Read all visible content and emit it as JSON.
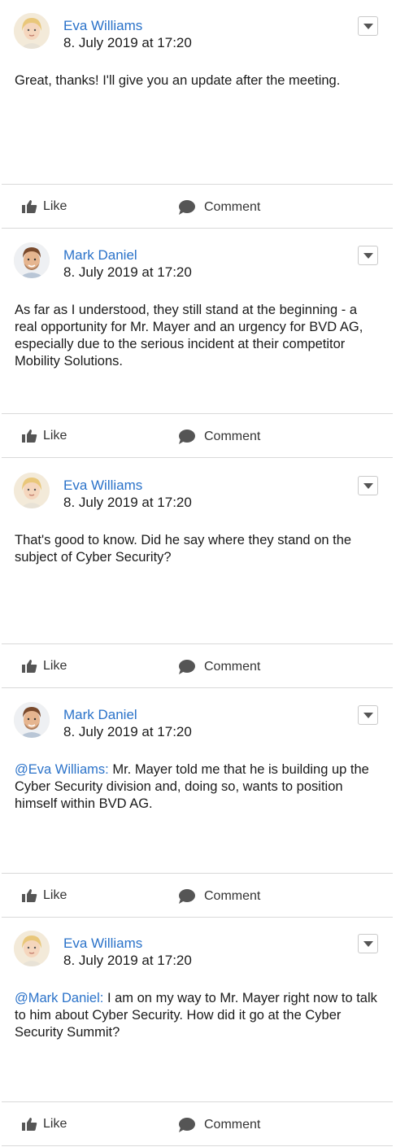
{
  "posts": [
    {
      "author": "Eva Williams",
      "avatar": "female-avatar",
      "date": "8. July 2019 at 17:20",
      "mention": "",
      "text": "Great, thanks! I'll give you an update after the meeting.",
      "like_label": "Like",
      "comment_label": "Comment"
    },
    {
      "author": "Mark Daniel",
      "avatar": "male-avatar",
      "date": "8. July 2019 at 17:20",
      "mention": "",
      "text": "As far as I understood, they still stand at the beginning - a real opportunity for Mr. Mayer and an urgency for BVD AG, especially due to the serious incident at their competitor Mobility Solutions.",
      "like_label": "Like",
      "comment_label": "Comment"
    },
    {
      "author": "Eva Williams",
      "avatar": "female-avatar",
      "date": "8. July 2019 at 17:20",
      "mention": "",
      "text": "That's good to know. Did he say where they stand on the subject of Cyber Security?",
      "like_label": "Like",
      "comment_label": "Comment"
    },
    {
      "author": "Mark Daniel",
      "avatar": "male-avatar",
      "date": "8. July 2019 at 17:20",
      "mention": "@Eva Williams:",
      "text": " Mr. Mayer told me that he is building up the Cyber Security division and, doing so, wants to position himself within BVD AG.",
      "like_label": "Like",
      "comment_label": "Comment"
    },
    {
      "author": "Eva Williams",
      "avatar": "female-avatar",
      "date": "8. July 2019 at 17:20",
      "mention": "@Mark Daniel:",
      "text": " I am on my way to Mr. Mayer right now to talk to him about Cyber Security. How did it go at the Cyber Security Summit?",
      "like_label": "Like",
      "comment_label": "Comment"
    }
  ],
  "icons": {
    "like": "thumbs-up-icon",
    "comment": "speech-bubble-icon",
    "menu": "chevron-down-icon"
  },
  "colors": {
    "link": "#2a72c9",
    "text": "#1a1a1a",
    "divider": "#d9d9d9",
    "icon": "#555555"
  }
}
